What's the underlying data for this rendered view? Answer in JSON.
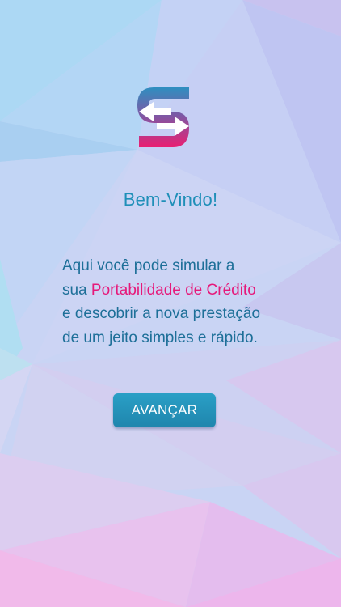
{
  "welcome": {
    "title": "Bem-Vindo!"
  },
  "intro": {
    "line1": "Aqui você pode simular a",
    "line2_prefix": "sua ",
    "line2_highlight": "Portabilidade de Crédito",
    "line3": "e descobrir a nova prestação",
    "line4": "de um jeito simples e rápido."
  },
  "actions": {
    "advance_label": "AVANÇAR"
  },
  "colors": {
    "accent": "#1f8fb8",
    "highlight": "#e6197a",
    "button": "#2596be"
  },
  "icons": {
    "logo": "swap-arrows-s-logo-icon"
  }
}
